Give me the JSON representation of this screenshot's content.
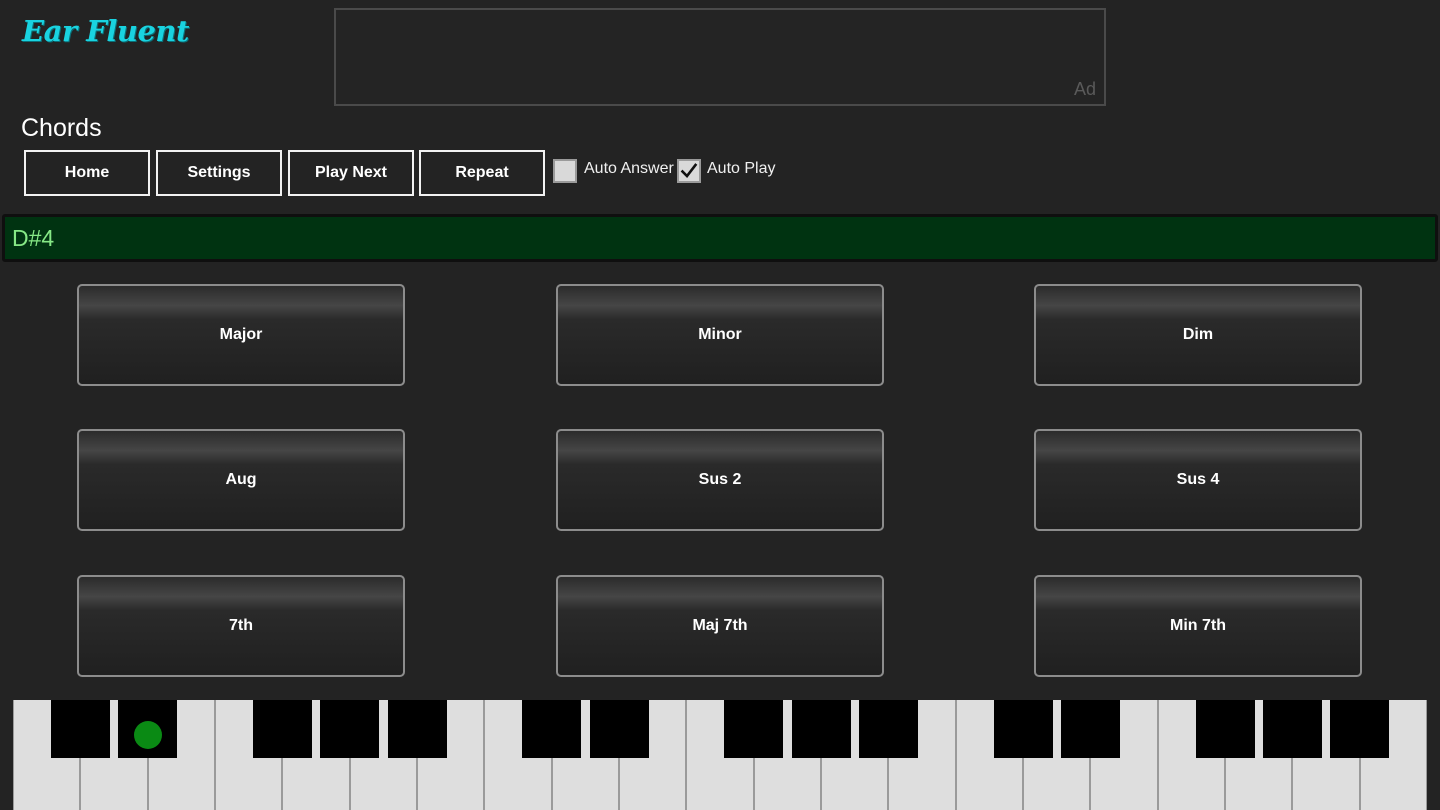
{
  "app": {
    "logo_text": "Ear Fluent",
    "logo_color": "#19d3e0"
  },
  "ad": {
    "label": "Ad"
  },
  "page": {
    "title": "Chords"
  },
  "toolbar": {
    "home_label": "Home",
    "settings_label": "Settings",
    "play_next_label": "Play Next",
    "repeat_label": "Repeat",
    "auto_answer": {
      "label": "Auto Answer",
      "checked": false
    },
    "auto_play": {
      "label": "Auto Play",
      "checked": true
    }
  },
  "status": {
    "text": "D#4",
    "bg_color": "#003311",
    "text_color": "#86e886"
  },
  "chords": [
    {
      "label": "Major"
    },
    {
      "label": "Minor"
    },
    {
      "label": "Dim"
    },
    {
      "label": "Aug"
    },
    {
      "label": "Sus 2"
    },
    {
      "label": "Sus 4"
    },
    {
      "label": "7th"
    },
    {
      "label": "Maj 7th"
    },
    {
      "label": "Min 7th"
    }
  ],
  "piano": {
    "white_keys": 21,
    "black_key_indices": [
      0,
      1,
      3,
      4,
      5,
      7,
      8,
      10,
      11,
      12,
      14,
      15,
      17,
      18,
      19
    ],
    "highlighted_note": "D#4",
    "highlight_color": "#0a8a14"
  }
}
